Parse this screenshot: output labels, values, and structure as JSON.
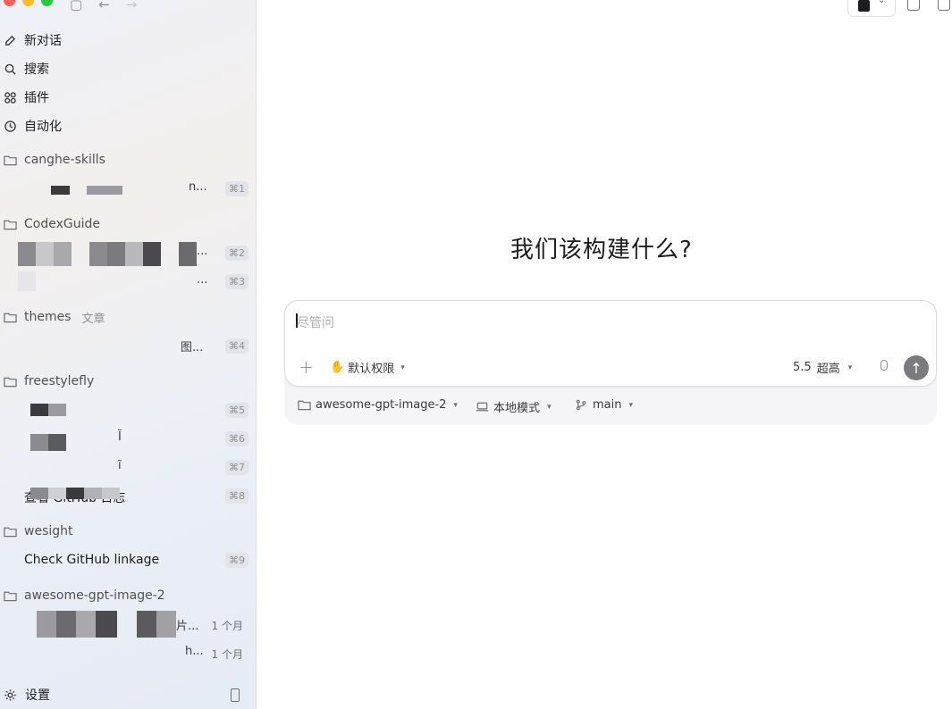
{
  "sidebar": {
    "nav": [
      {
        "label": "新对话",
        "icon": "edit-icon"
      },
      {
        "label": "搜索",
        "icon": "search-icon"
      },
      {
        "label": "插件",
        "icon": "plugins-icon"
      },
      {
        "label": "自动化",
        "icon": "clock-icon"
      }
    ],
    "projects": [
      {
        "name": "canghe-skills",
        "tag": "",
        "threads": [
          {
            "ellipsis": "n...",
            "shortcut": "⌘1"
          }
        ]
      },
      {
        "name": "CodexGuide",
        "tag": "",
        "threads": [
          {
            "ellipsis": "...",
            "shortcut": "⌘2"
          },
          {
            "ellipsis": "...",
            "shortcut": "⌘3"
          }
        ]
      },
      {
        "name": "themes",
        "tag": "文章",
        "threads": [
          {
            "ellipsis": "图...",
            "shortcut": "⌘4"
          }
        ]
      },
      {
        "name": "freestylefly",
        "tag": "",
        "threads": [
          {
            "ellipsis": "",
            "shortcut": "⌘5"
          },
          {
            "ellipsis": "Ĩ",
            "shortcut": "⌘6"
          },
          {
            "ellipsis": "ĩ",
            "shortcut": "⌘7"
          },
          {
            "ellipsis": "查看 GitHub 日志",
            "shortcut": "⌘8"
          }
        ]
      },
      {
        "name": "wesight",
        "tag": "",
        "threads": [
          {
            "title": "Check GitHub linkage",
            "shortcut": "⌘9"
          }
        ]
      },
      {
        "name": "awesome-gpt-image-2",
        "tag": "",
        "threads": [
          {
            "ellipsis": "片...",
            "age": "1 个月"
          },
          {
            "ellipsis": "h...",
            "age": "1 个月"
          }
        ]
      }
    ],
    "settings_label": "设置"
  },
  "main": {
    "headline": "我们该构建什么?",
    "composer": {
      "placeholder": "尽管问",
      "permission": "默认权限",
      "model": "5.5",
      "effort": "超高"
    },
    "under": {
      "repo": "awesome-gpt-image-2",
      "mode": "本地模式",
      "branch": "main"
    }
  },
  "colors": {
    "send": "#7a7a7f",
    "close": "#ff5f57",
    "minimize": "#febc2e",
    "zoom": "#28c840"
  }
}
